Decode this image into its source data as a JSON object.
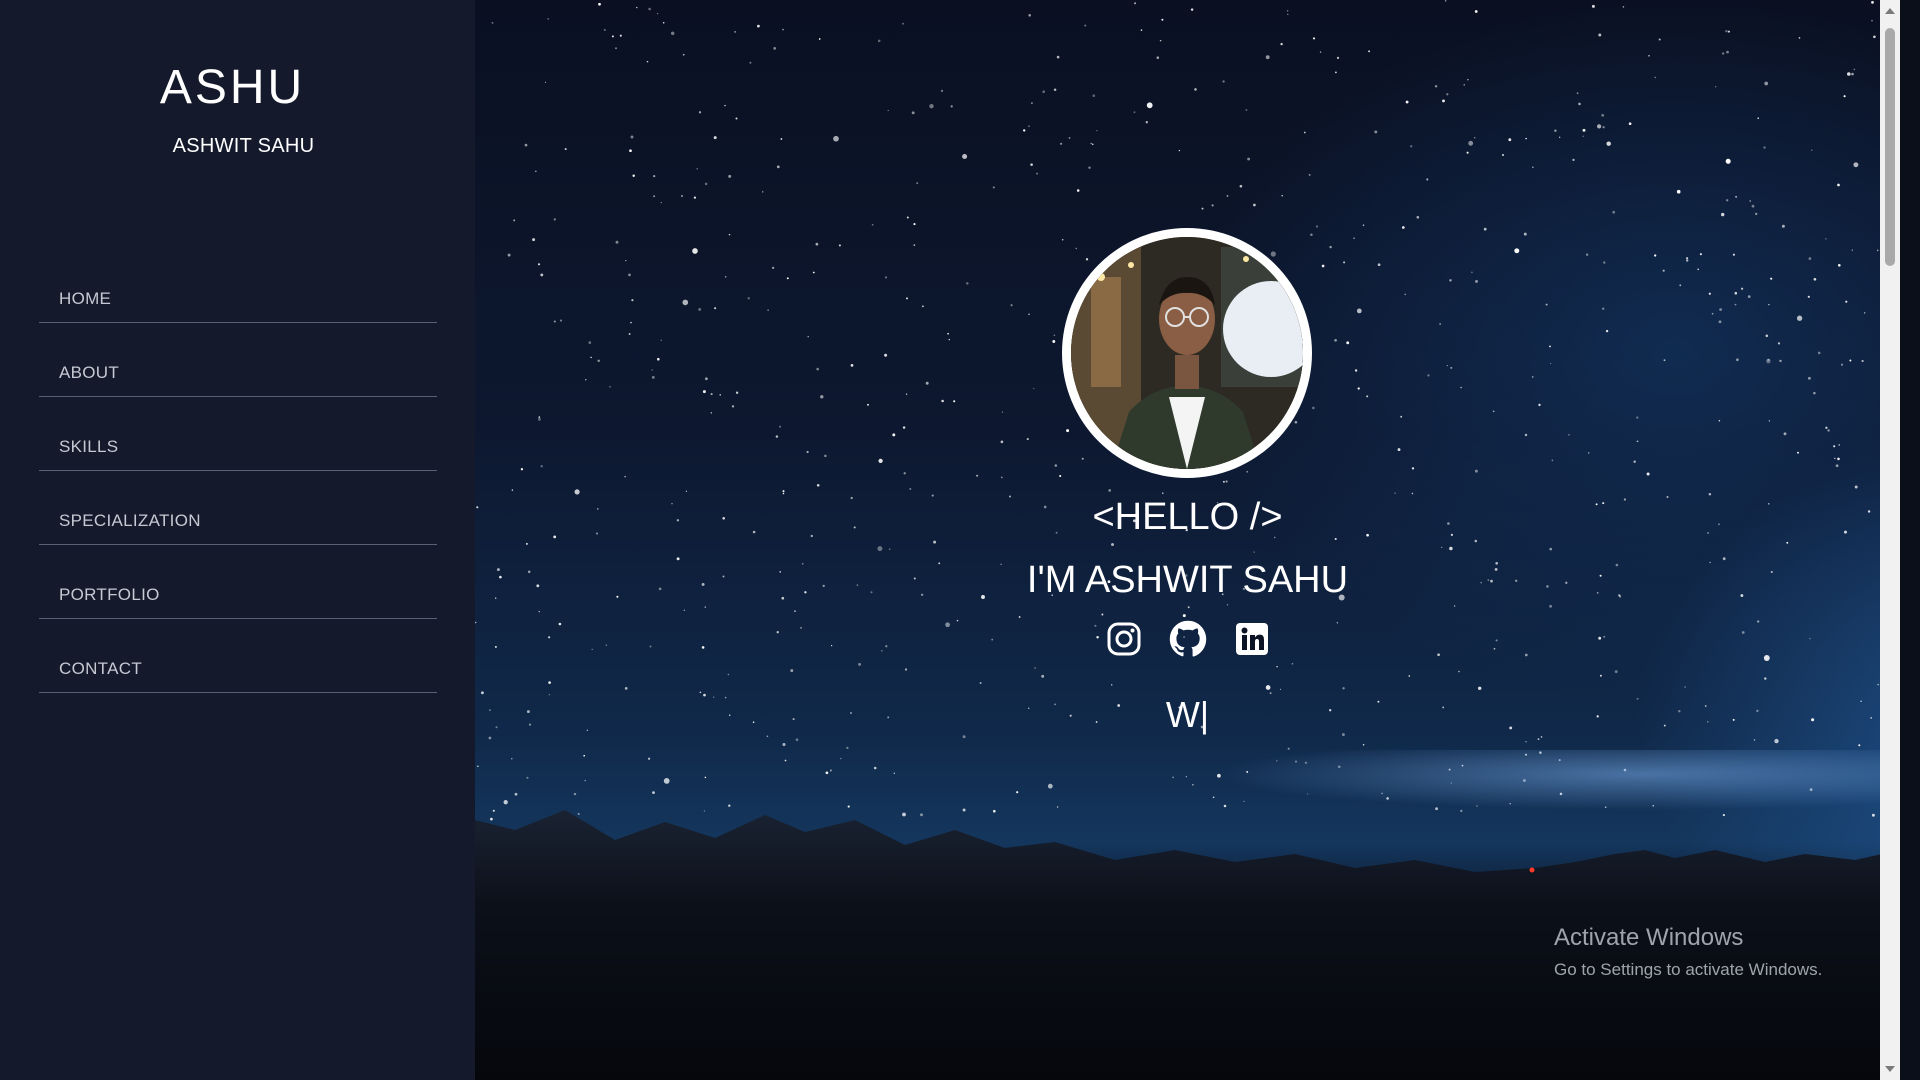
{
  "sidebar": {
    "logo": "ASHU",
    "full_name": "ASHWIT SAHU",
    "nav": [
      {
        "label": "HOME"
      },
      {
        "label": "ABOUT"
      },
      {
        "label": "SKILLS"
      },
      {
        "label": "SPECIALIZATION"
      },
      {
        "label": "PORTFOLIO"
      },
      {
        "label": "CONTACT"
      }
    ]
  },
  "hero": {
    "greeting": "<HELLO />",
    "intro": "I'M ASHWIT SAHU",
    "typed_text": "W|",
    "social": [
      {
        "icon": "instagram-icon"
      },
      {
        "icon": "github-icon"
      },
      {
        "icon": "linkedin-icon"
      }
    ]
  },
  "watermark": {
    "title": "Activate Windows",
    "subtitle": "Go to Settings to activate Windows."
  },
  "colors": {
    "sidebar_bg": "#141a2b",
    "nav_text": "#c5c9d3",
    "divider": "#5b6175",
    "text_white": "#ffffff"
  }
}
